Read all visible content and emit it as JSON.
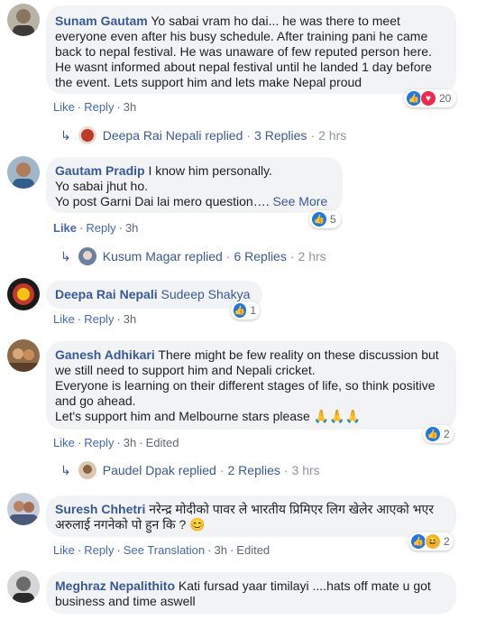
{
  "comments": [
    {
      "author": "Sunam Gautam",
      "text": "Yo sabai vram ho dai... he was there to meet everyone even after his busy schedule. After training pani he came back to nepal festival. He was unaware of few reputed person here. He wasnt informed about nepal festival until he landed 1 day before the event. Lets support him and lets make Nepal proud",
      "actions": {
        "like": "Like",
        "reply": "Reply",
        "time": "3h"
      },
      "reaction_count": "20",
      "reply_summary": {
        "name": "Deepa Rai Nepali replied",
        "count": "3 Replies",
        "time": "2 hrs"
      }
    },
    {
      "author": "Gautam Pradip",
      "line1": "I know him personally.",
      "line2": "Yo sabai jhut ho.",
      "line3": "Yo post Garni Dai lai mero question….",
      "see_more": "See More",
      "actions": {
        "like": "Like",
        "reply": "Reply",
        "time": "3h"
      },
      "reaction_count": "5",
      "reply_summary": {
        "name": "Kusum Magar replied",
        "count": "6 Replies",
        "time": "2 hrs"
      }
    },
    {
      "author": "Deepa Rai Nepali",
      "text": "Sudeep Shakya",
      "actions": {
        "like": "Like",
        "reply": "Reply",
        "time": "3h"
      },
      "reaction_count": "1"
    },
    {
      "author": "Ganesh Adhikari",
      "text": "There might be few reality on these discussion but we still need to support him and Nepali cricket.\nEveryone is learning on their different stages of life, so think positive and go ahead.\nLet's support him and Melbourne stars please 🙏🙏🙏",
      "actions": {
        "like": "Like",
        "reply": "Reply",
        "time": "3h",
        "edited": "Edited"
      },
      "reaction_count": "2",
      "reply_summary": {
        "name": "Paudel Dpak replied",
        "count": "2 Replies",
        "time": "3 hrs"
      }
    },
    {
      "author": "Suresh Chhetri",
      "text": "नरेन्द्र मोदीको पावर ले भारतीय प्रिमिएर लिग खेलेर आएको भएर अरुलाई नगनेको पो हुन कि ? 😊",
      "actions": {
        "like": "Like",
        "reply": "Reply",
        "translation": "See Translation",
        "time": "3h",
        "edited": "Edited"
      },
      "reaction_count": "2"
    },
    {
      "author": "Meghraz Nepalithito",
      "text": "Kati fursad yaar timilayi ....hats off mate u got business and time aswell"
    }
  ],
  "colors": {
    "bubble_bg": "#f2f3f5",
    "author": "#385898",
    "link": "#4267b2",
    "meta": "#606770",
    "like": "#1877f2",
    "love": "#f0284a",
    "haha": "#f7b125"
  },
  "icons": [
    "like-reaction-icon",
    "love-reaction-icon",
    "haha-reaction-icon",
    "reply-arrow-icon"
  ]
}
